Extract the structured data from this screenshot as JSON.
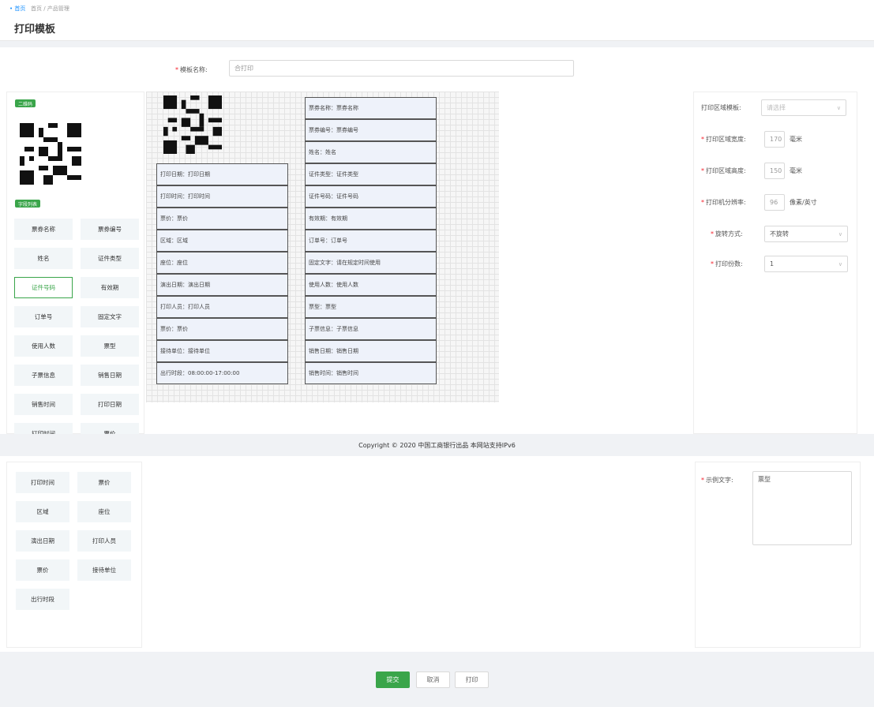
{
  "breadcrumb": {
    "home": "• 首页",
    "rest": "首页 / 产品管理"
  },
  "page": {
    "title": "打印模板"
  },
  "template_name": {
    "label": "模板名称:",
    "value": "合打印"
  },
  "left": {
    "qr_tag": "二维码",
    "fields_tag": "字段列表",
    "items_upper": [
      "票券名称",
      "票券编号",
      "姓名",
      "证件类型",
      "证件号码",
      "有效期",
      "订单号",
      "固定文字",
      "使用人数",
      "票型",
      "子票信息",
      "销售日期",
      "销售时间",
      "打印日期",
      "打印时间",
      "票价"
    ],
    "items_lower": [
      "打印时间",
      "票价",
      "区域",
      "座位",
      "演出日期",
      "打印人员",
      "票价",
      "接待单位",
      "出行时段"
    ],
    "active_item": "证件号码"
  },
  "canvas": {
    "left_cells": [
      "打印日期：打印日期",
      "打印时间：打印时间",
      "票价：票价",
      "区域：区域",
      "座位：座位",
      "演出日期：演出日期",
      "打印人员：打印人员",
      "票价：票价",
      "接待单位：接待单位",
      "出行时段：08:00:00-17:00:00"
    ],
    "right_cells": [
      "票券名称：票券名称",
      "票券编号：票券编号",
      "姓名：姓名",
      "证件类型：证件类型",
      "证件号码：证件号码",
      "有效期：有效期",
      "订单号：订单号",
      "固定文字：请在规定时间使用",
      "使用人数：使用人数",
      "票型：票型",
      "子票信息：子票信息",
      "销售日期：销售日期",
      "销售时间：销售时间"
    ]
  },
  "right": {
    "print_area_type": {
      "label": "打印区域模板:",
      "value": "请选择"
    },
    "area_width": {
      "label": "打印区域宽度:",
      "value": "170",
      "unit": "毫米"
    },
    "area_height": {
      "label": "打印区域高度:",
      "value": "150",
      "unit": "毫米"
    },
    "resolution": {
      "label": "打印机分辨率:",
      "value": "96",
      "unit": "像素/英寸"
    },
    "rotation": {
      "label": "旋转方式:",
      "value": "不旋转"
    },
    "copies": {
      "label": "打印份数:",
      "value": "1"
    },
    "fixed_text": {
      "label": "示例文字:",
      "value": "票型"
    }
  },
  "footer": {
    "copyright": "Copyright © 2020 中国工商银行出品 本网站支持IPv6"
  },
  "actions": {
    "save": "提交",
    "cancel": "取消",
    "print": "打印"
  },
  "colors": {
    "primary": "#3aa54a",
    "required": "#f5222d"
  }
}
